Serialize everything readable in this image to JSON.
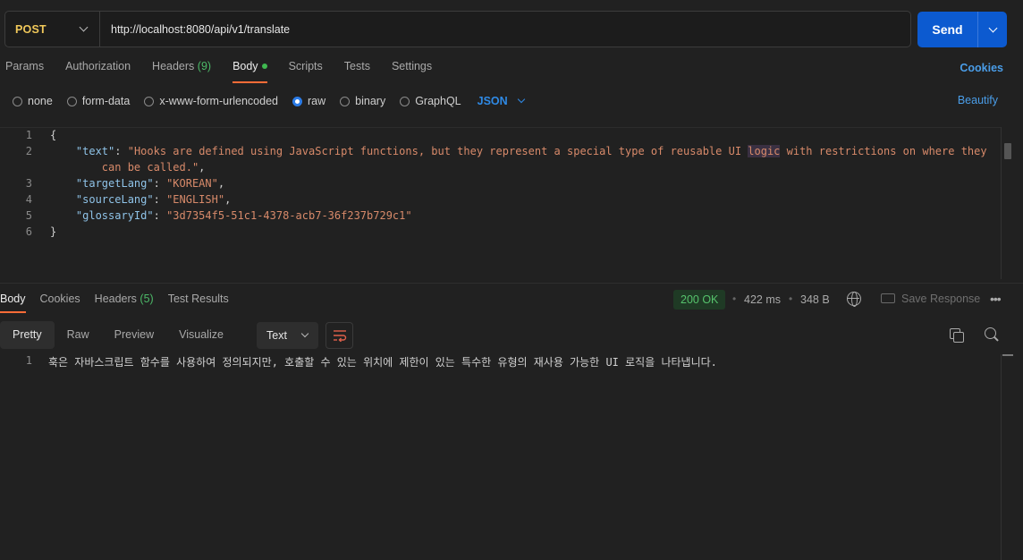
{
  "request": {
    "method": "POST",
    "url": "http://localhost:8080/api/v1/translate",
    "send_label": "Send"
  },
  "request_tabs": [
    {
      "label": "Params"
    },
    {
      "label": "Authorization"
    },
    {
      "label": "Headers",
      "count": "(9)"
    },
    {
      "label": "Body",
      "active": true,
      "indicator": "green-dot"
    },
    {
      "label": "Scripts"
    },
    {
      "label": "Tests"
    },
    {
      "label": "Settings"
    }
  ],
  "cookies_label": "Cookies",
  "body_types": [
    {
      "label": "none"
    },
    {
      "label": "form-data"
    },
    {
      "label": "x-www-form-urlencoded"
    },
    {
      "label": "raw",
      "selected": true
    },
    {
      "label": "binary"
    },
    {
      "label": "GraphQL"
    }
  ],
  "language": "JSON",
  "beautify_label": "Beautify",
  "editor": {
    "line_numbers": [
      "1",
      "2",
      "",
      "3",
      "4",
      "5",
      "6"
    ],
    "lines": {
      "l1": "{",
      "l2_key": "\"text\"",
      "l2_colon": ": ",
      "l2_val_a": "\"Hooks are defined using JavaScript functions, but they represent a special type of reusable UI ",
      "l2_val_hl": "logic",
      "l2_val_b": " with restrictions on where they",
      "l2_cont": "can be called.\"",
      "l2_comma": ",",
      "l3_key": "\"targetLang\"",
      "l3_val": "\"KOREAN\"",
      "l4_key": "\"sourceLang\"",
      "l4_val": "\"ENGLISH\"",
      "l5_key": "\"glossaryId\"",
      "l5_val": "\"3d7354f5-51c1-4378-acb7-36f237b729c1\"",
      "l6": "}"
    },
    "colon": ": ",
    "comma": ","
  },
  "response_tabs": [
    {
      "label": "Body",
      "active": true
    },
    {
      "label": "Cookies"
    },
    {
      "label": "Headers",
      "count": "(5)"
    },
    {
      "label": "Test Results"
    }
  ],
  "response_meta": {
    "status": "200 OK",
    "time": "422 ms",
    "size": "348 B",
    "separator": "•",
    "save_label": "Save Response",
    "more": "•••"
  },
  "view_modes": [
    {
      "label": "Pretty",
      "active": true
    },
    {
      "label": "Raw"
    },
    {
      "label": "Preview"
    },
    {
      "label": "Visualize"
    }
  ],
  "format": "Text",
  "response_body": {
    "line_number": "1",
    "text": "훅은 자바스크립트 함수를 사용하여 정의되지만, 호출할 수 있는 위치에 제한이 있는 특수한 유형의 재사용 가능한 UI 로직을 나타냅니다."
  },
  "colors": {
    "accent_orange": "#ff6c37",
    "send_blue": "#0c5ad0",
    "method_yellow": "#f0c85a",
    "status_green": "#56c26c"
  }
}
